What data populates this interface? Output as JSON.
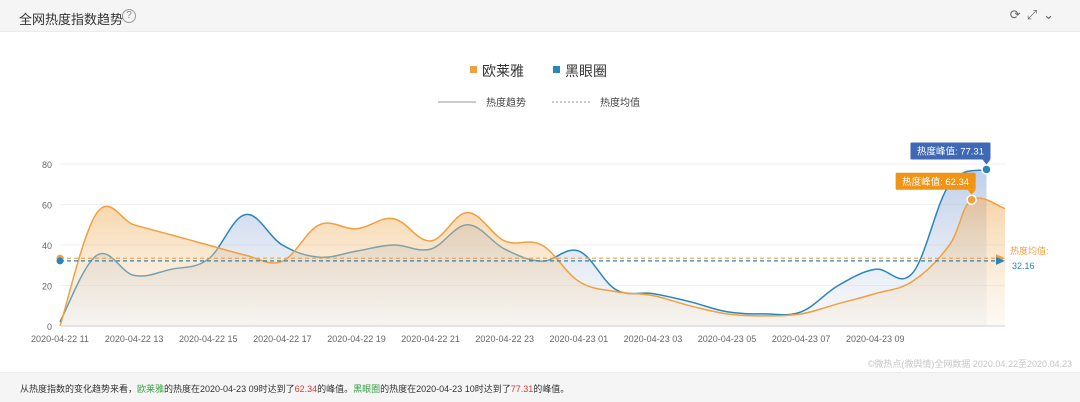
{
  "header": {
    "title": "全网热度指数趋势",
    "help_glyph": "?",
    "tools": {
      "refresh": "⟳",
      "expand": "⤢",
      "more": "⌄"
    }
  },
  "legend": {
    "series": [
      {
        "name": "欧莱雅",
        "color": "#f0a040"
      },
      {
        "name": "黑眼圈",
        "color": "#2a86b8"
      }
    ],
    "styles": [
      {
        "name": "热度趋势",
        "style": "solid"
      },
      {
        "name": "热度均值",
        "style": "dashed"
      }
    ]
  },
  "chart_data": {
    "type": "area",
    "ylim": [
      0,
      80
    ],
    "yticks": [
      0,
      20,
      40,
      60,
      80
    ],
    "x_labels": [
      "2020-04-22 11",
      "2020-04-22 13",
      "2020-04-22 15",
      "2020-04-22 17",
      "2020-04-22 19",
      "2020-04-22 21",
      "2020-04-22 23",
      "2020-04-23 01",
      "2020-04-23 03",
      "2020-04-23 05",
      "2020-04-23 07",
      "2020-04-23 09"
    ],
    "series": [
      {
        "name": "欧莱雅",
        "color": "#f0a040",
        "values": [
          [
            0,
            0
          ],
          [
            1,
            56
          ],
          [
            2,
            50
          ],
          [
            3,
            45
          ],
          [
            4,
            40
          ],
          [
            5,
            35
          ],
          [
            6,
            32
          ],
          [
            7,
            50
          ],
          [
            8,
            48
          ],
          [
            9,
            53
          ],
          [
            10,
            42
          ],
          [
            11,
            56
          ],
          [
            12,
            42
          ],
          [
            13,
            40
          ],
          [
            14,
            22
          ],
          [
            15,
            17
          ],
          [
            16,
            15
          ],
          [
            17,
            10
          ],
          [
            18,
            6
          ],
          [
            19,
            5
          ],
          [
            20,
            6
          ],
          [
            21,
            11
          ],
          [
            22,
            16
          ],
          [
            23,
            22
          ],
          [
            24,
            40
          ],
          [
            24.6,
            62.34
          ],
          [
            25.5,
            58
          ]
        ],
        "peak": {
          "x": 24.6,
          "value": 62.34,
          "label": "热度峰值: 62.34"
        },
        "mean": 33.5,
        "mean_label": "热度均值:"
      },
      {
        "name": "黑眼圈",
        "color": "#2a86b8",
        "values": [
          [
            0,
            2
          ],
          [
            1,
            35
          ],
          [
            2,
            25
          ],
          [
            3,
            28
          ],
          [
            4,
            33
          ],
          [
            5,
            55
          ],
          [
            6,
            40
          ],
          [
            7,
            34
          ],
          [
            8,
            37
          ],
          [
            9,
            40
          ],
          [
            10,
            38
          ],
          [
            11,
            50
          ],
          [
            12,
            38
          ],
          [
            13,
            32
          ],
          [
            14,
            37
          ],
          [
            15,
            18
          ],
          [
            16,
            16
          ],
          [
            17,
            12
          ],
          [
            18,
            7
          ],
          [
            19,
            6
          ],
          [
            20,
            7
          ],
          [
            21,
            20
          ],
          [
            22,
            28
          ],
          [
            23,
            26
          ],
          [
            24,
            70
          ],
          [
            25,
            77.31
          ]
        ],
        "peak": {
          "x": 25,
          "value": 77.31,
          "label": "热度峰值: 77.31"
        },
        "mean": 32.16,
        "mean_label": "32.16"
      }
    ]
  },
  "footer": {
    "summary_prefix": "从热度指数的变化趋势来看，",
    "brand1": "欧莱雅",
    "mid1": "的热度在2020-04-23 09时达到了",
    "peak1": "62.34",
    "mid2": "的峰值。",
    "brand2": "黑眼圈",
    "mid3": "的热度在2020-04-23 10时达到了",
    "peak2": "77.31",
    "end": "的峰值。",
    "credit": "©微热点(微舆情)全网数据 2020.04.22至2020.04.23"
  }
}
